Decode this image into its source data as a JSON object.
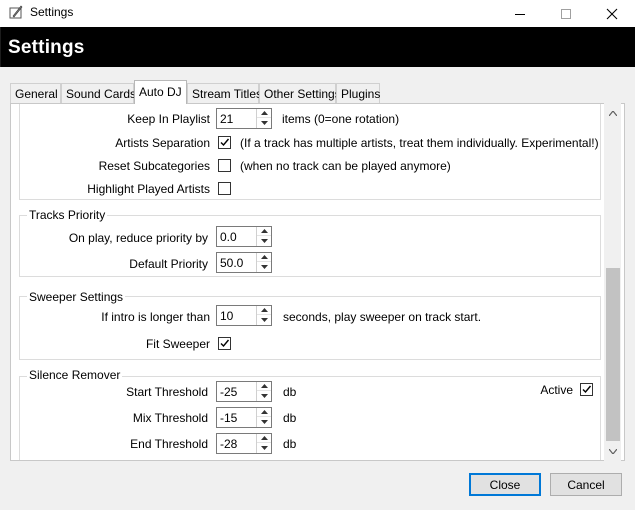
{
  "window": {
    "title": "Settings",
    "header_title": "Settings"
  },
  "tabs": [
    {
      "label": "General"
    },
    {
      "label": "Sound Cards"
    },
    {
      "label": "Auto DJ",
      "active": true
    },
    {
      "label": "Stream Titles"
    },
    {
      "label": "Other Settings"
    },
    {
      "label": "Plugins"
    }
  ],
  "autodj": {
    "keep_in_playlist": {
      "label": "Keep In Playlist",
      "value": "21",
      "note": "items (0=one rotation)"
    },
    "artists_separation": {
      "label": "Artists Separation",
      "checked": true,
      "note": "(If a track has multiple artists, treat them individually. Experimental!)"
    },
    "reset_subcategories": {
      "label": "Reset Subcategories",
      "checked": false,
      "note": "(when no track can be played anymore)"
    },
    "highlight_played_artists": {
      "label": "Highlight Played Artists",
      "checked": false
    }
  },
  "tracks_priority": {
    "title": "Tracks Priority",
    "reduce_priority": {
      "label": "On play, reduce priority by",
      "value": "0.0"
    },
    "default_priority": {
      "label": "Default Priority",
      "value": "50.0"
    }
  },
  "sweeper": {
    "title": "Sweeper Settings",
    "intro_longer": {
      "label": "If intro is longer than",
      "value": "10",
      "note": "seconds, play sweeper on track start."
    },
    "fit_sweeper": {
      "label": "Fit Sweeper",
      "checked": true
    }
  },
  "silence_remover": {
    "title": "Silence Remover",
    "start_threshold": {
      "label": "Start Threshold",
      "value": "-25",
      "unit": "db"
    },
    "mix_threshold": {
      "label": "Mix Threshold",
      "value": "-15",
      "unit": "db"
    },
    "end_threshold": {
      "label": "End Threshold",
      "value": "-28",
      "unit": "db"
    },
    "active": {
      "label": "Active",
      "checked": true
    }
  },
  "buttons": {
    "close": "Close",
    "cancel": "Cancel"
  },
  "colors": {
    "header_bg": "#000000",
    "default_button_border": "#0078d7",
    "scroll_thumb": "#c2c2c2"
  }
}
